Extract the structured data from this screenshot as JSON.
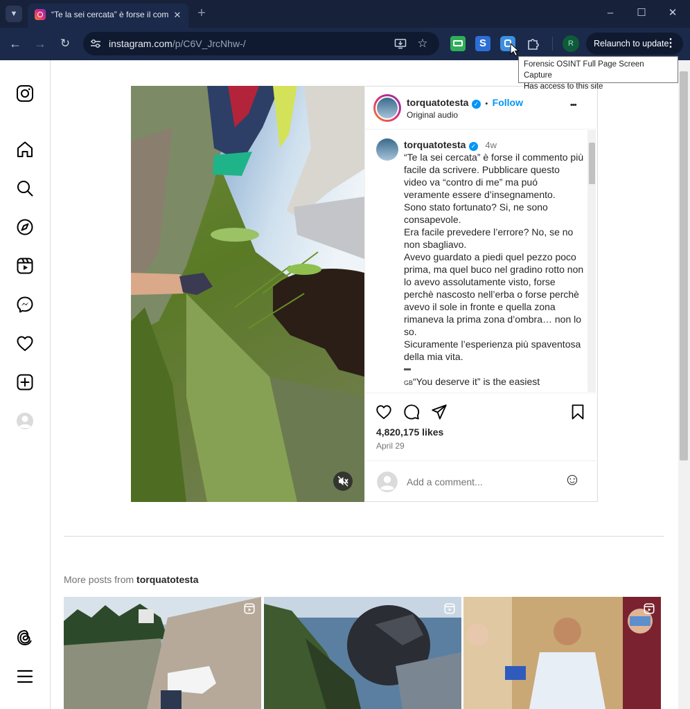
{
  "browser": {
    "tab_title": "“Te la sei cercata” è forse il commento",
    "url_domain": "instagram.com",
    "url_path": "/p/C6V_JrcNhw-/",
    "new_tab_symbol": "+",
    "profile_initial": "R",
    "relaunch_label": "Relaunch to update",
    "ext_s_label": "S",
    "tooltip_line1": "Forensic OSINT Full Page Screen Capture",
    "tooltip_line2": "Has access to this site",
    "window_controls": [
      "–",
      "☐",
      "✕"
    ]
  },
  "sidebar": {
    "items": [
      "instagram-logo",
      "home",
      "search",
      "explore",
      "reels",
      "messages",
      "notifications",
      "create",
      "profile",
      "threads",
      "more"
    ]
  },
  "post": {
    "header": {
      "username": "torquatotesta",
      "follow_label": "Follow",
      "dot": "•",
      "audio": "Original audio",
      "more_label": "•••"
    },
    "caption": {
      "username": "torquatotesta",
      "age": "4w",
      "lines": [
        "“Te la sei cercata” è forse il commento più facile da scrivere. Pubblicare questo video va “contro di me” ma puó veramente essere d’insegnamento.",
        "Sono stato fortunato? Si, ne sono consapevole.",
        "Era facile prevedere l’errore? No, se no non sbagliavo.",
        "Avevo guardato a piedi quel pezzo poco prima, ma quel buco nel gradino rotto non lo avevo assolutamente visto, forse perchè nascosto nell’erba o forse perchè avevo il sole in fronte e quella zona rimaneva la prima zona d’ombra… non lo so.",
        "Sicuramente l’esperienza più spaventosa della mia vita."
      ],
      "separator": "▬",
      "english_flag": "GB",
      "english_start": "“You deserve it” is the easiest"
    },
    "likes": "4,820,175 likes",
    "date": "April 29",
    "comment_placeholder": "Add a comment...",
    "emoji_label": "☺"
  },
  "more_posts": {
    "prefix": "More posts from",
    "username": "torquatotesta",
    "thumbnails": [
      "reel-1",
      "reel-2",
      "reel-3"
    ]
  }
}
